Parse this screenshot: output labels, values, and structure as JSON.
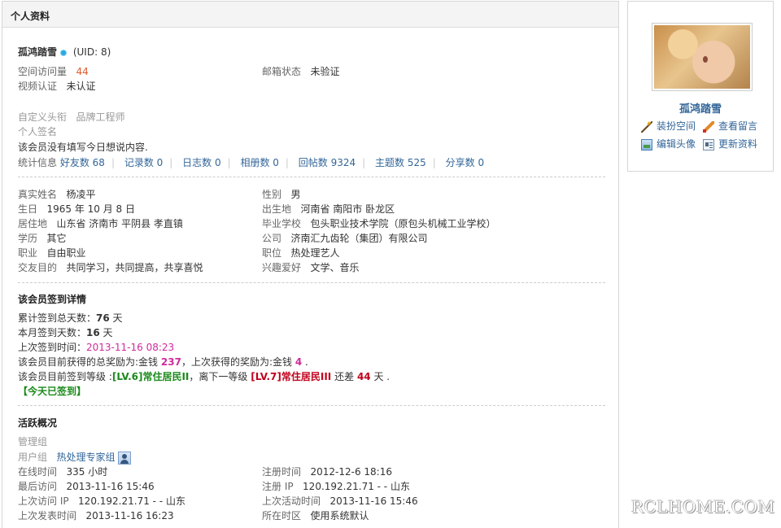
{
  "header": {
    "title": "个人资料"
  },
  "profile": {
    "username": "孤鸿踏雪",
    "uid": "(UID: 8)",
    "visits_label": "空间访问量",
    "visits_value": "44",
    "email_label": "邮箱状态",
    "email_value": "未验证",
    "video_label": "视频认证",
    "video_value": "未认证",
    "title_label": "自定义头衔",
    "title_value": "品牌工程师",
    "signature_label": "个人签名",
    "status_text": "该会员没有填写今日想说内容.",
    "stats_label": "统计信息",
    "stats": [
      {
        "label": "好友数 68"
      },
      {
        "label": "记录数 0"
      },
      {
        "label": "日志数 0"
      },
      {
        "label": "相册数 0"
      },
      {
        "label": "回帖数 9324"
      },
      {
        "label": "主题数 525"
      },
      {
        "label": "分享数 0"
      }
    ]
  },
  "details": {
    "left": [
      {
        "label": "真实姓名",
        "value": "杨凌平"
      },
      {
        "label": "生日",
        "value": "1965 年 10 月 8 日"
      },
      {
        "label": "居住地",
        "value": "山东省 济南市 平阴县 孝直镇"
      },
      {
        "label": "学历",
        "value": "其它"
      },
      {
        "label": "职业",
        "value": "自由职业"
      },
      {
        "label": "交友目的",
        "value": "共同学习，共同提高，共享喜悦"
      }
    ],
    "right": [
      {
        "label": "性别",
        "value": "男"
      },
      {
        "label": "出生地",
        "value": "河南省 南阳市 卧龙区"
      },
      {
        "label": "毕业学校",
        "value": "包头职业技术学院（原包头机械工业学校）"
      },
      {
        "label": "公司",
        "value": "济南汇九齿轮（集团）有限公司"
      },
      {
        "label": "职位",
        "value": "热处理艺人"
      },
      {
        "label": "兴趣爱好",
        "value": "文学、音乐"
      }
    ]
  },
  "signin": {
    "title": "该会员签到详情",
    "total_label": "累计签到总天数：",
    "total_value": "76",
    "day_unit": "天",
    "month_label": "本月签到天数：",
    "month_value": "16",
    "last_label": "上次签到时间：",
    "last_value": "2013-11-16 08:23",
    "reward_prefix": "该会员目前获得的总奖励为:金钱",
    "reward_total": "237",
    "reward_mid": "，上次获得的奖励为:金钱",
    "reward_last": "4",
    "reward_end": ".",
    "level_prefix": "该会员目前签到等级 :",
    "level_current": "[LV.6]常住居民II",
    "level_mid": "，离下一等级",
    "level_next": "[LV.7]常住居民III",
    "level_gap_label": "还差",
    "level_gap_value": "44",
    "level_end": "天 .",
    "today": "【今天已签到】"
  },
  "activity": {
    "title": "活跃概况",
    "admin_group_label": "管理组",
    "user_group_label": "用户组",
    "user_group_value": "热处理专家组",
    "left": [
      {
        "label": "在线时间",
        "value": "335 小时"
      },
      {
        "label": "最后访问",
        "value": "2013-11-16 15:46"
      },
      {
        "label": "上次访问 IP",
        "value": "120.192.21.71 - - 山东"
      },
      {
        "label": "上次发表时间",
        "value": "2013-11-16 16:23"
      }
    ],
    "right": [
      {
        "label": "注册时间",
        "value": "2012-12-6 18:16"
      },
      {
        "label": "注册 IP",
        "value": "120.192.21.71 - - 山东"
      },
      {
        "label": "上次活动时间",
        "value": "2013-11-16 15:46"
      },
      {
        "label": "所在时区",
        "value": "使用系统默认"
      }
    ]
  },
  "sidebar": {
    "name": "孤鸿踏雪",
    "links": [
      {
        "label": "装扮空间",
        "icon": "magic-wand-icon"
      },
      {
        "label": "查看留言",
        "icon": "pencil-icon"
      },
      {
        "label": "编辑头像",
        "icon": "picture-icon"
      },
      {
        "label": "更新资料",
        "icon": "profile-card-icon"
      }
    ]
  },
  "watermark": "RCLHOME.COM"
}
